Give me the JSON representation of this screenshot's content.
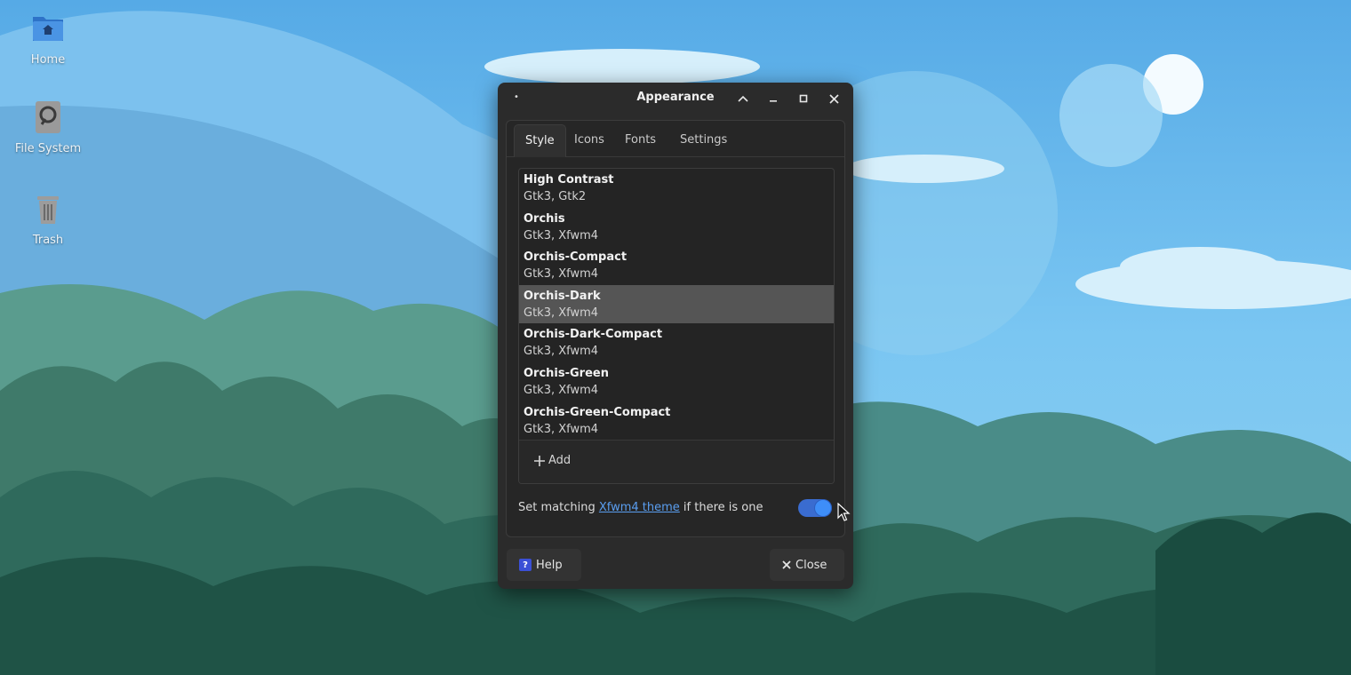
{
  "desktop": {
    "icons": [
      {
        "label": "Home",
        "icon": "home-folder-icon"
      },
      {
        "label": "File System",
        "icon": "drive-icon"
      },
      {
        "label": "Trash",
        "icon": "trash-icon"
      }
    ]
  },
  "window": {
    "title": "Appearance",
    "tabs": [
      {
        "label": "Style",
        "active": true
      },
      {
        "label": "Icons",
        "active": false
      },
      {
        "label": "Fonts",
        "active": false
      },
      {
        "label": "Settings",
        "active": false
      }
    ],
    "themes": [
      {
        "name": "High Contrast",
        "sub": "Gtk3, Gtk2",
        "selected": false
      },
      {
        "name": "Orchis",
        "sub": "Gtk3, Xfwm4",
        "selected": false
      },
      {
        "name": "Orchis-Compact",
        "sub": "Gtk3, Xfwm4",
        "selected": false
      },
      {
        "name": "Orchis-Dark",
        "sub": "Gtk3, Xfwm4",
        "selected": true
      },
      {
        "name": "Orchis-Dark-Compact",
        "sub": "Gtk3, Xfwm4",
        "selected": false
      },
      {
        "name": "Orchis-Green",
        "sub": "Gtk3, Xfwm4",
        "selected": false
      },
      {
        "name": "Orchis-Green-Compact",
        "sub": "Gtk3, Xfwm4",
        "selected": false
      }
    ],
    "add_label": "Add",
    "match_prefix": "Set matching ",
    "match_link": "Xfwm4 theme",
    "match_suffix": " if there is one",
    "match_toggle_on": true,
    "help_label": "Help",
    "close_label": "Close"
  },
  "colors": {
    "accent": "#3e8ef8",
    "link": "#5a9ef0",
    "window_bg": "#2b2b2b",
    "selected_row": "#555555"
  }
}
